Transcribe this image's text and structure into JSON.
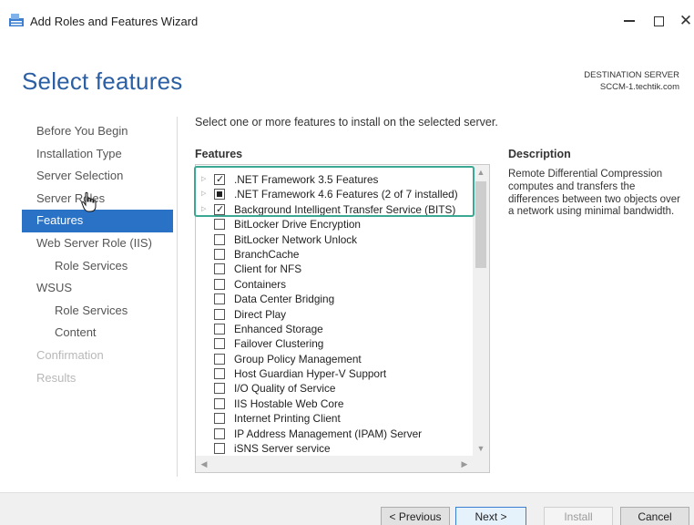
{
  "window": {
    "title": "Add Roles and Features Wizard",
    "min_glyph": "—",
    "max_glyph": "□",
    "close_glyph": "✕"
  },
  "header": {
    "page_title": "Select features",
    "destination_label": "DESTINATION SERVER",
    "destination_server": "SCCM-1.techtik.com"
  },
  "nav": {
    "items": [
      {
        "label": "Before You Begin",
        "state": "normal"
      },
      {
        "label": "Installation Type",
        "state": "normal"
      },
      {
        "label": "Server Selection",
        "state": "normal"
      },
      {
        "label": "Server Roles",
        "state": "normal"
      },
      {
        "label": "Features",
        "state": "selected"
      },
      {
        "label": "Web Server Role (IIS)",
        "state": "normal"
      },
      {
        "label": "Role Services",
        "state": "sub"
      },
      {
        "label": "WSUS",
        "state": "normal"
      },
      {
        "label": "Role Services",
        "state": "sub"
      },
      {
        "label": "Content",
        "state": "sub"
      },
      {
        "label": "Confirmation",
        "state": "disabled"
      },
      {
        "label": "Results",
        "state": "disabled"
      }
    ]
  },
  "main": {
    "instruction": "Select one or more features to install on the selected server.",
    "features_heading": "Features",
    "description_heading": "Description",
    "description_text": "Remote Differential Compression computes and transfers the differences between two objects over a network using minimal bandwidth.",
    "features": [
      {
        "label": ".NET Framework 3.5 Features",
        "state": "checked",
        "expandable": true
      },
      {
        "label": ".NET Framework 4.6 Features (2 of 7 installed)",
        "state": "partial",
        "expandable": true
      },
      {
        "label": "Background Intelligent Transfer Service (BITS)",
        "state": "checked",
        "expandable": true
      },
      {
        "label": "BitLocker Drive Encryption",
        "state": "unchecked",
        "expandable": false
      },
      {
        "label": "BitLocker Network Unlock",
        "state": "unchecked",
        "expandable": false
      },
      {
        "label": "BranchCache",
        "state": "unchecked",
        "expandable": false
      },
      {
        "label": "Client for NFS",
        "state": "unchecked",
        "expandable": false
      },
      {
        "label": "Containers",
        "state": "unchecked",
        "expandable": false
      },
      {
        "label": "Data Center Bridging",
        "state": "unchecked",
        "expandable": false
      },
      {
        "label": "Direct Play",
        "state": "unchecked",
        "expandable": false
      },
      {
        "label": "Enhanced Storage",
        "state": "unchecked",
        "expandable": false
      },
      {
        "label": "Failover Clustering",
        "state": "unchecked",
        "expandable": false
      },
      {
        "label": "Group Policy Management",
        "state": "unchecked",
        "expandable": false
      },
      {
        "label": "Host Guardian Hyper-V Support",
        "state": "unchecked",
        "expandable": false
      },
      {
        "label": "I/O Quality of Service",
        "state": "unchecked",
        "expandable": false
      },
      {
        "label": "IIS Hostable Web Core",
        "state": "unchecked",
        "expandable": false
      },
      {
        "label": "Internet Printing Client",
        "state": "unchecked",
        "expandable": false
      },
      {
        "label": "IP Address Management (IPAM) Server",
        "state": "unchecked",
        "expandable": false
      },
      {
        "label": "iSNS Server service",
        "state": "unchecked",
        "expandable": false
      }
    ],
    "highlight_color": "#3aa892"
  },
  "footer": {
    "previous_label": "< Previous",
    "next_label": "Next >",
    "install_label": "Install",
    "cancel_label": "Cancel"
  },
  "colors": {
    "accent": "#2a72c6",
    "title_blue": "#2b5fa4"
  }
}
